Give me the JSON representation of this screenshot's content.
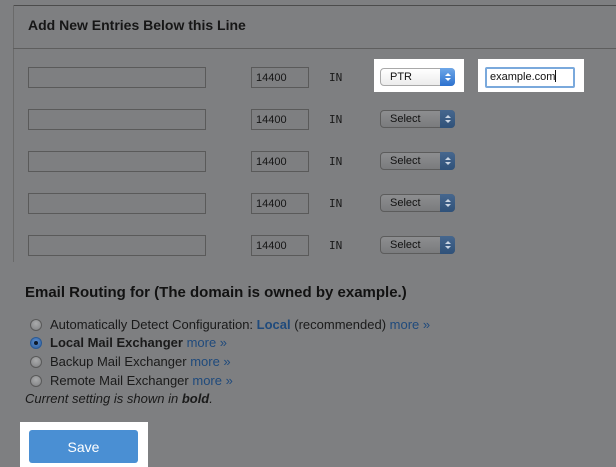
{
  "zone_section": {
    "title": "Add New Entries Below this Line",
    "rows": [
      {
        "ttl": "14400",
        "class": "IN",
        "type": "PTR",
        "data": "example.com"
      },
      {
        "ttl": "14400",
        "class": "IN",
        "type": "Select"
      },
      {
        "ttl": "14400",
        "class": "IN",
        "type": "Select"
      },
      {
        "ttl": "14400",
        "class": "IN",
        "type": "Select"
      },
      {
        "ttl": "14400",
        "class": "IN",
        "type": "Select"
      }
    ]
  },
  "email_routing": {
    "title": "Email Routing for (The domain is owned by example.)",
    "options": [
      {
        "label": "Automatically Detect Configuration:",
        "value": "Local",
        "suffix": "(recommended)",
        "more": "more »",
        "checked": false
      },
      {
        "label": "Local Mail Exchanger",
        "more": "more »",
        "checked": true
      },
      {
        "label": "Backup Mail Exchanger",
        "more": "more »",
        "checked": false
      },
      {
        "label": "Remote Mail Exchanger",
        "more": "more »",
        "checked": false
      }
    ],
    "note_prefix": "Current setting is shown in",
    "note_bold": "bold",
    "note_suffix": "."
  },
  "save_label": "Save",
  "colors": {
    "accent": "#4a8fd3",
    "link": "#1f4a7c",
    "overlay_bg": "#7e7f81"
  }
}
